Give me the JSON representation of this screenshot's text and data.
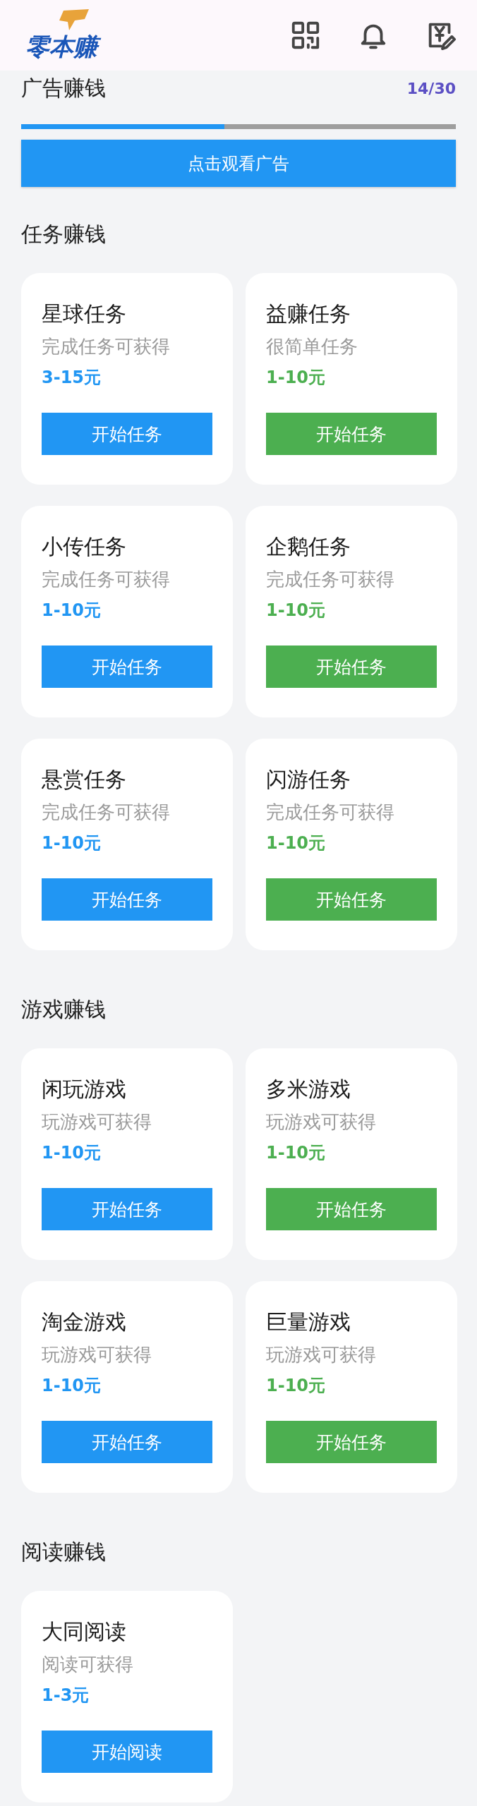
{
  "header": {
    "logo_text": "零本赚"
  },
  "ad_section": {
    "title": "广告赚钱",
    "count": "14/30",
    "level": 0.467,
    "button": "点击观看广告"
  },
  "sections": [
    {
      "title": "任务赚钱",
      "cards": [
        {
          "title": "星球任务",
          "subtitle": "完成任务可获得",
          "reward": "3-15元",
          "button": "开始任务",
          "color": "#2196f3"
        },
        {
          "title": "益赚任务",
          "subtitle": "很简单任务",
          "reward": "1-10元",
          "button": "开始任务",
          "color": "#4caf50"
        },
        {
          "title": "小传任务",
          "subtitle": "完成任务可获得",
          "reward": "1-10元",
          "button": "开始任务",
          "color": "#2196f3"
        },
        {
          "title": "企鹅任务",
          "subtitle": "完成任务可获得",
          "reward": "1-10元",
          "button": "开始任务",
          "color": "#4caf50"
        },
        {
          "title": "悬赏任务",
          "subtitle": "完成任务可获得",
          "reward": "1-10元",
          "button": "开始任务",
          "color": "#2196f3"
        },
        {
          "title": "闪游任务",
          "subtitle": "完成任务可获得",
          "reward": "1-10元",
          "button": "开始任务",
          "color": "#4caf50"
        }
      ]
    },
    {
      "title": "游戏赚钱",
      "cards": [
        {
          "title": "闲玩游戏",
          "subtitle": "玩游戏可获得",
          "reward": "1-10元",
          "button": "开始任务",
          "color": "#2196f3"
        },
        {
          "title": "多米游戏",
          "subtitle": "玩游戏可获得",
          "reward": "1-10元",
          "button": "开始任务",
          "color": "#4caf50"
        },
        {
          "title": "淘金游戏",
          "subtitle": "玩游戏可获得",
          "reward": "1-10元",
          "button": "开始任务",
          "color": "#2196f3"
        },
        {
          "title": "巨量游戏",
          "subtitle": "玩游戏可获得",
          "reward": "1-10元",
          "button": "开始任务",
          "color": "#4caf50"
        }
      ]
    },
    {
      "title": "阅读赚钱",
      "cards": [
        {
          "title": "大同阅读",
          "subtitle": "阅读可获得",
          "reward": "1-3元",
          "button": "开始阅读",
          "color": "#2196f3"
        }
      ]
    }
  ]
}
